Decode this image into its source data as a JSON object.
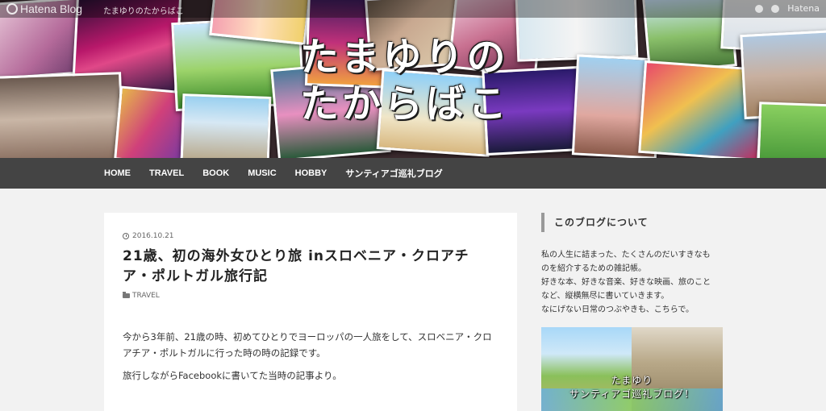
{
  "hatena_bar": {
    "logo": "Hatena Blog",
    "blog_name": "たまゆりのたからばこ",
    "right_label": "Hatena"
  },
  "header": {
    "title_line1": "たまゆりの",
    "title_line2": "たからばこ"
  },
  "nav": {
    "items": [
      "HOME",
      "TRAVEL",
      "BOOK",
      "MUSIC",
      "HOBBY",
      "サンティアゴ巡礼ブログ"
    ]
  },
  "article": {
    "date": "2016.10.21",
    "title": "21歳、初の海外女ひとり旅 inスロベニア・クロアチア・ポルトガル旅行記",
    "category": "TRAVEL",
    "paragraphs": [
      "今から3年前、21歳の時、初めてひとりでヨーロッパの一人旅をして、スロベニア・クロアチア・ポルトガルに行った時の時の記録です。",
      "旅行しながらFacebookに書いてた当時の記事より。"
    ]
  },
  "sidebar": {
    "heading": "このブログについて",
    "description_lines": [
      "私の人生に詰まった、たくさんのだいすきなも",
      "のを紹介するための雑記帳。",
      "好きな本、好きな音楽、好きな映画、旅のこと",
      "など、縦横無尽に書いていきます。",
      "なにげない日常のつぶやきも、こちらで。"
    ],
    "image_text_line1": "たまゆり",
    "image_text_line2": "サンティアゴ巡礼ブログ！"
  },
  "colors": {
    "nav_bg": "#444444",
    "page_bg": "#f2f2f2",
    "card_bg": "#ffffff"
  },
  "icons": [
    "hatena-logo-icon",
    "clock-icon",
    "folder-icon"
  ]
}
